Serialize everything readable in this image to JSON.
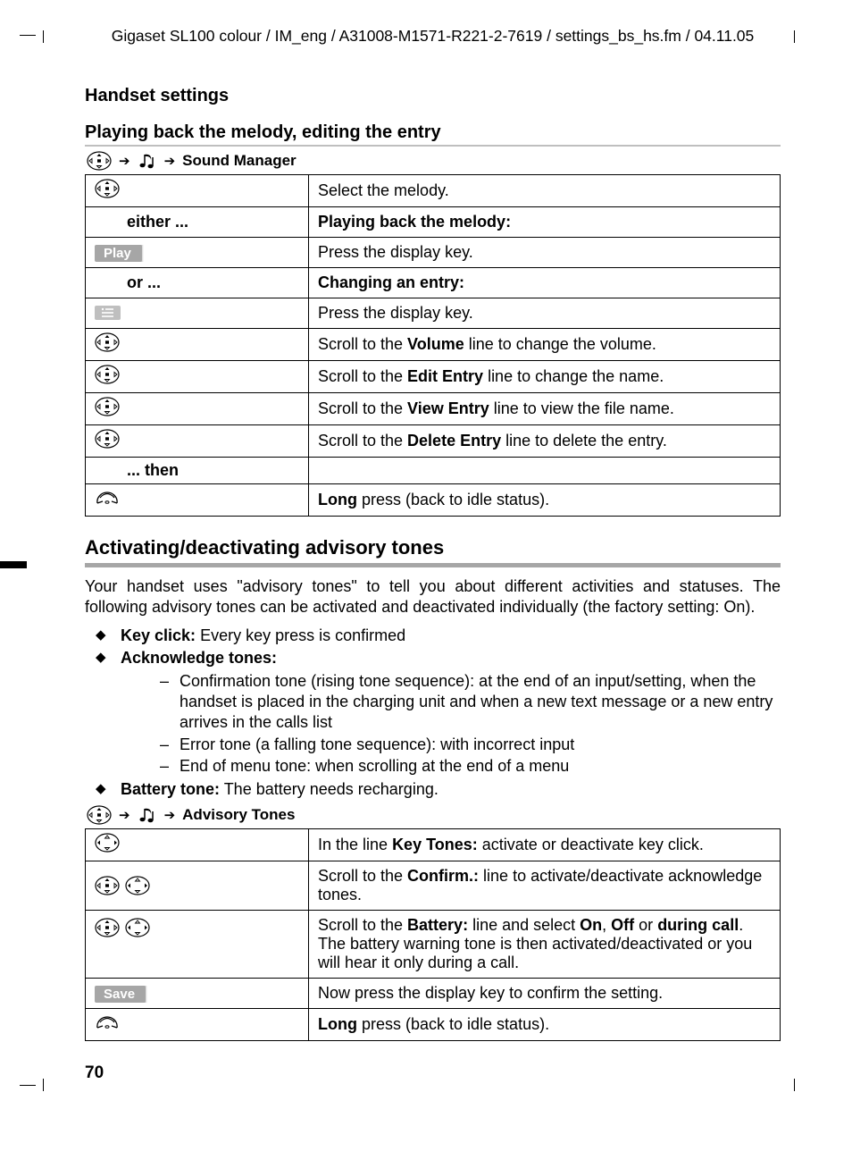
{
  "header": "Gigaset SL100 colour / IM_eng / A31008-M1571-R221-2-7619 / settings_bs_hs.fm / 04.11.05",
  "section_title": "Handset settings",
  "sub1_title": "Playing back the melody, editing the entry",
  "nav1_end": "Sound Manager",
  "t1": {
    "r1_right": "Select the melody.",
    "r2_left": "either ...",
    "r2_right": "Playing back the melody:",
    "r3_softkey": "Play",
    "r3_right": "Press the display key.",
    "r4_left": "or ...",
    "r4_right": "Changing an entry:",
    "r5_right": "Press the display key.",
    "r6_right_a": "Scroll to the ",
    "r6_right_b": "Volume",
    "r6_right_c": " line to change the volume.",
    "r7_right_a": "Scroll to the ",
    "r7_right_b": "Edit Entry",
    "r7_right_c": " line to change the name.",
    "r8_right_a": "Scroll to the ",
    "r8_right_b": "View Entry",
    "r8_right_c": " line to view the file name.",
    "r9_right_a": "Scroll to the ",
    "r9_right_b": "Delete Entry",
    "r9_right_c": " line to delete the entry.",
    "r10_left": "... then",
    "r11_right_a": "Long",
    "r11_right_b": " press (back to idle status)."
  },
  "h2_big": "Activating/deactivating advisory tones",
  "para1": "Your handset uses \"advisory tones\" to tell you about different activities and statuses. The following advisory tones can be activated and deactivated individually (the factory setting: On).",
  "b1_label": "Key click:",
  "b1_text": " Every key press is confirmed",
  "b2_label": "Acknowledge tones:",
  "b2_s1": "Confirmation tone (rising tone sequence): at the end of an input/setting, when the handset is placed in the charging unit and when a new text message or a new entry arrives in the calls list",
  "b2_s2": "Error tone (a falling tone sequence): with incorrect input",
  "b2_s3": "End of menu tone: when scrolling at the end of a menu",
  "b3_label": "Battery tone:",
  "b3_text": " The battery needs recharging.",
  "nav2_end": "Advisory Tones",
  "t2": {
    "r1_a": "In the line ",
    "r1_b": "Key Tones:",
    "r1_c": " activate or deactivate key click.",
    "r2_a": "Scroll to the ",
    "r2_b": "Confirm.:",
    "r2_c": " line to activate/deactivate acknowledge tones.",
    "r3_a": "Scroll to the ",
    "r3_b": "Battery:",
    "r3_c": " line and select ",
    "r3_d": "On",
    "r3_e": ", ",
    "r3_f": "Off",
    "r3_g": " or ",
    "r3_h": "during call",
    "r3_i": ". The battery warning tone is then activated/deactivated or you will hear it only during a call.",
    "r4_softkey": "Save",
    "r4_right": "Now press the display key to confirm the setting.",
    "r5_a": "Long",
    "r5_b": " press (back to idle status)."
  },
  "page_number": "70"
}
